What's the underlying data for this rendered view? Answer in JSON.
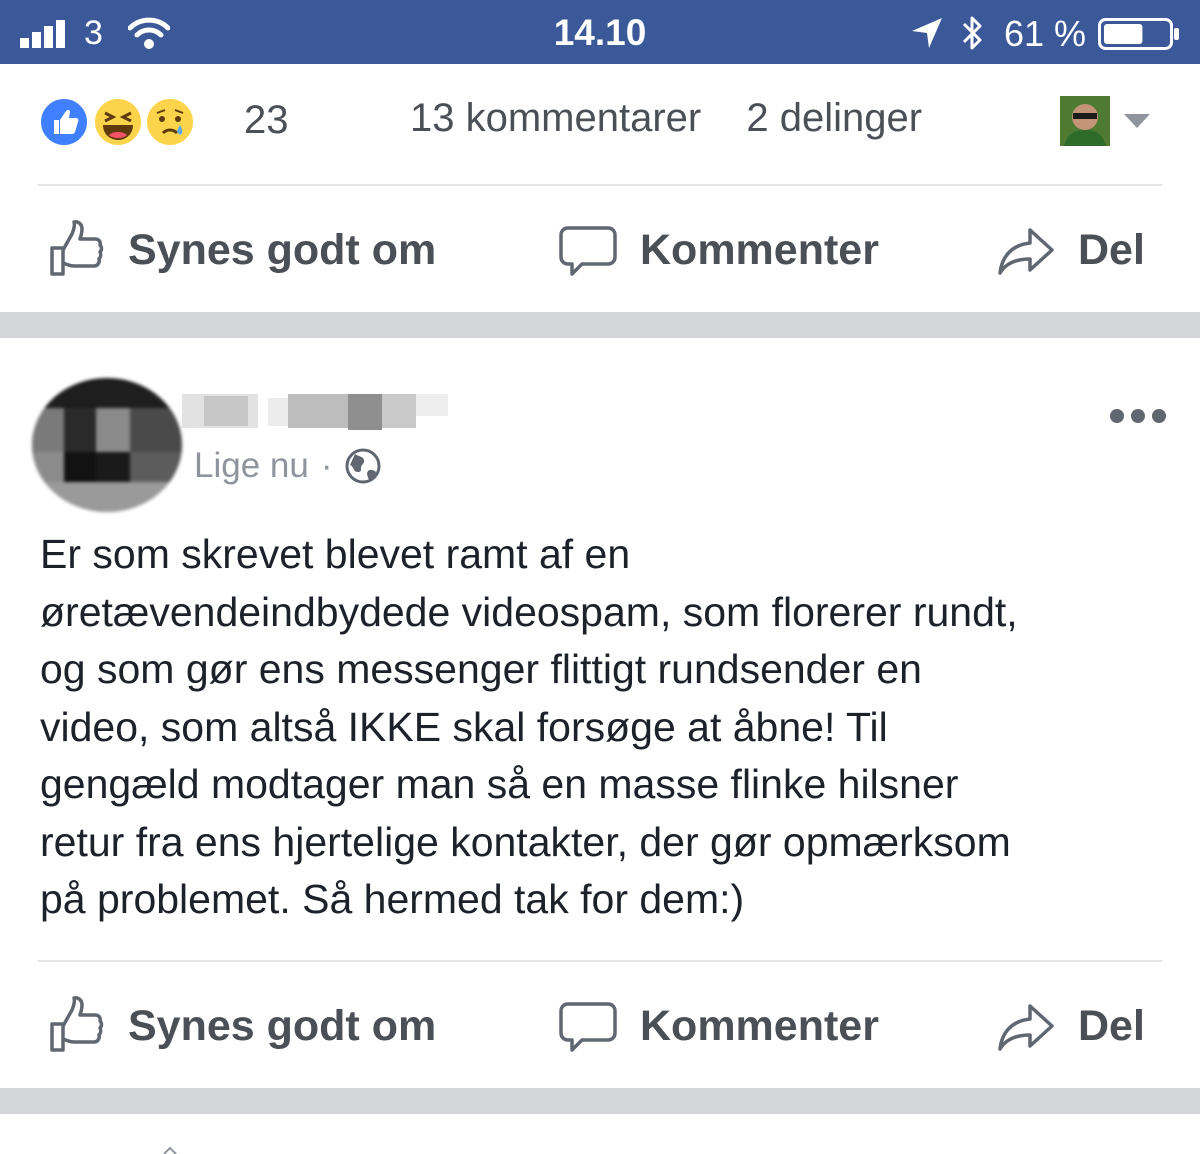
{
  "status_bar": {
    "carrier": "3",
    "time": "14.10",
    "battery_text": "61 %",
    "battery_level": 0.61,
    "icons": [
      "signal-icon",
      "wifi-icon",
      "location-icon",
      "bluetooth-icon",
      "battery-icon"
    ]
  },
  "post1": {
    "reaction_count": "23",
    "reactions": [
      "like",
      "haha",
      "sad"
    ],
    "comments": "13 kommentarer",
    "shares": "2 delinger"
  },
  "actions": {
    "like": "Synes godt om",
    "comment": "Kommenter",
    "share": "Del"
  },
  "post2": {
    "timestamp": "Lige nu",
    "separator": "·",
    "privacy_icon": "globe-icon",
    "text": "Er som skrevet blevet ramt af en\nøretævendeindbydede videospam, som florerer rundt,\nog som gør ens messenger flittigt rundsender en\nvideo, som altså IKKE skal forsøge at åbne! Til\ngengæld modtager man så en masse flinke hilsner\nretur fra ens hjertelige kontakter, der gør opmærksom\npå problemet. Så hermed tak for dem:)"
  },
  "colors": {
    "header_blue": "#3b5998",
    "like_blue": "#4080ff",
    "emoji_yellow": "#fbd44b",
    "secondary_text": "#4b4f56",
    "meta_text": "#90949c",
    "separator_gray": "#d3d5d8"
  }
}
